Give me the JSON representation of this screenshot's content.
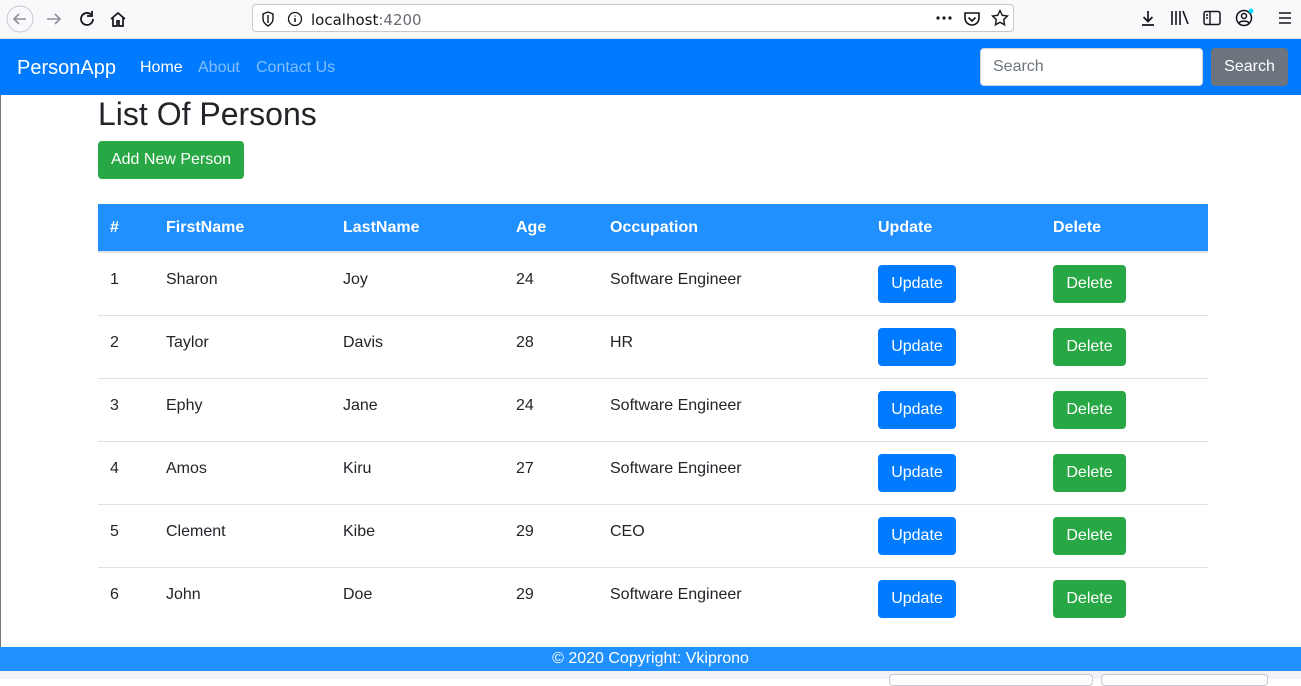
{
  "browser": {
    "url_host": "localhost",
    "url_port": ":4200",
    "icons": [
      "back-icon",
      "forward-icon",
      "reload-icon",
      "home-icon",
      "shield-icon",
      "info-icon",
      "more-icon",
      "pocket-icon",
      "star-icon",
      "download-icon",
      "library-icon",
      "sidebar-icon",
      "account-icon",
      "menu-icon"
    ]
  },
  "navbar": {
    "brand": "PersonApp",
    "links": [
      "Home",
      "About",
      "Contact Us"
    ],
    "search_placeholder": "Search",
    "search_button": "Search",
    "color": "#007bff"
  },
  "page": {
    "title": "List Of Persons",
    "add_button": "Add New Person"
  },
  "table": {
    "headers": [
      "#",
      "FirstName",
      "LastName",
      "Age",
      "Occupation",
      "Update",
      "Delete"
    ],
    "rows": [
      {
        "id": "1",
        "first": "Sharon",
        "last": "Joy",
        "age": "24",
        "occupation": "Software Engineer"
      },
      {
        "id": "2",
        "first": "Taylor",
        "last": "Davis",
        "age": "28",
        "occupation": "HR"
      },
      {
        "id": "3",
        "first": "Ephy",
        "last": "Jane",
        "age": "24",
        "occupation": "Software Engineer"
      },
      {
        "id": "4",
        "first": "Amos",
        "last": "Kiru",
        "age": "27",
        "occupation": "Software Engineer"
      },
      {
        "id": "5",
        "first": "Clement",
        "last": "Kibe",
        "age": "29",
        "occupation": "CEO"
      },
      {
        "id": "6",
        "first": "John",
        "last": "Doe",
        "age": "29",
        "occupation": "Software Engineer"
      }
    ],
    "update_label": "Update",
    "delete_label": "Delete",
    "header_color": "#2190ff"
  },
  "footer": {
    "text": "© 2020 Copyright: Vkiprono"
  }
}
